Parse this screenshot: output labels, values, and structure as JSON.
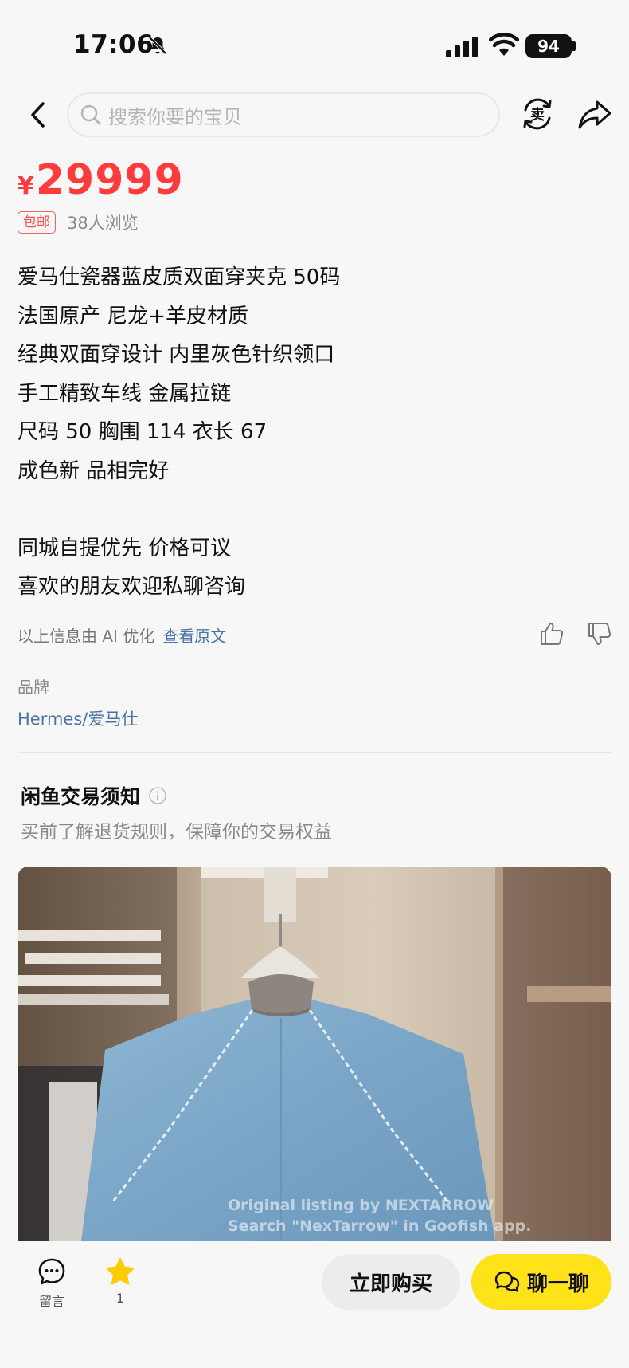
{
  "status_bar": {
    "time": "17:06",
    "battery": "94"
  },
  "search": {
    "placeholder": "搜索你要的宝贝"
  },
  "price": {
    "currency": "¥",
    "amount": "29999"
  },
  "tags": {
    "shipping": "包邮",
    "views": "38人浏览"
  },
  "description": [
    "爱马仕瓷器蓝皮质双面穿夹克 50码",
    "法国原产 尼龙+羊皮材质",
    "经典双面穿设计 内里灰色针织领口",
    "手工精致车线 金属拉链",
    "尺码 50 胸围 114 衣长 67",
    "成色新 品相完好",
    "",
    "同城自提优先 价格可议",
    "喜欢的朋友欢迎私聊咨询"
  ],
  "ai_notice": {
    "text": "以上信息由 AI 优化",
    "link": "查看原文"
  },
  "brand": {
    "label": "品牌",
    "value": "Hermes/爱马仕"
  },
  "trade_notice": {
    "title": "闲鱼交易须知",
    "subtitle": "买前了解退货规则，保障你的交易权益"
  },
  "photo": {
    "watermark_line1": "Original listing by  NEXTARROW",
    "watermark_line2": "Search \"NexTarrow\" in Goofish app."
  },
  "bottom_bar": {
    "comment_label": "留言",
    "favorite_count": "1",
    "buy_label": "立即购买",
    "chat_label": "聊一聊"
  },
  "colors": {
    "price": "#ff3b3b",
    "link": "#4a73a8",
    "chat_button": "#ffe21a",
    "favorite_star": "#ffcc00"
  }
}
